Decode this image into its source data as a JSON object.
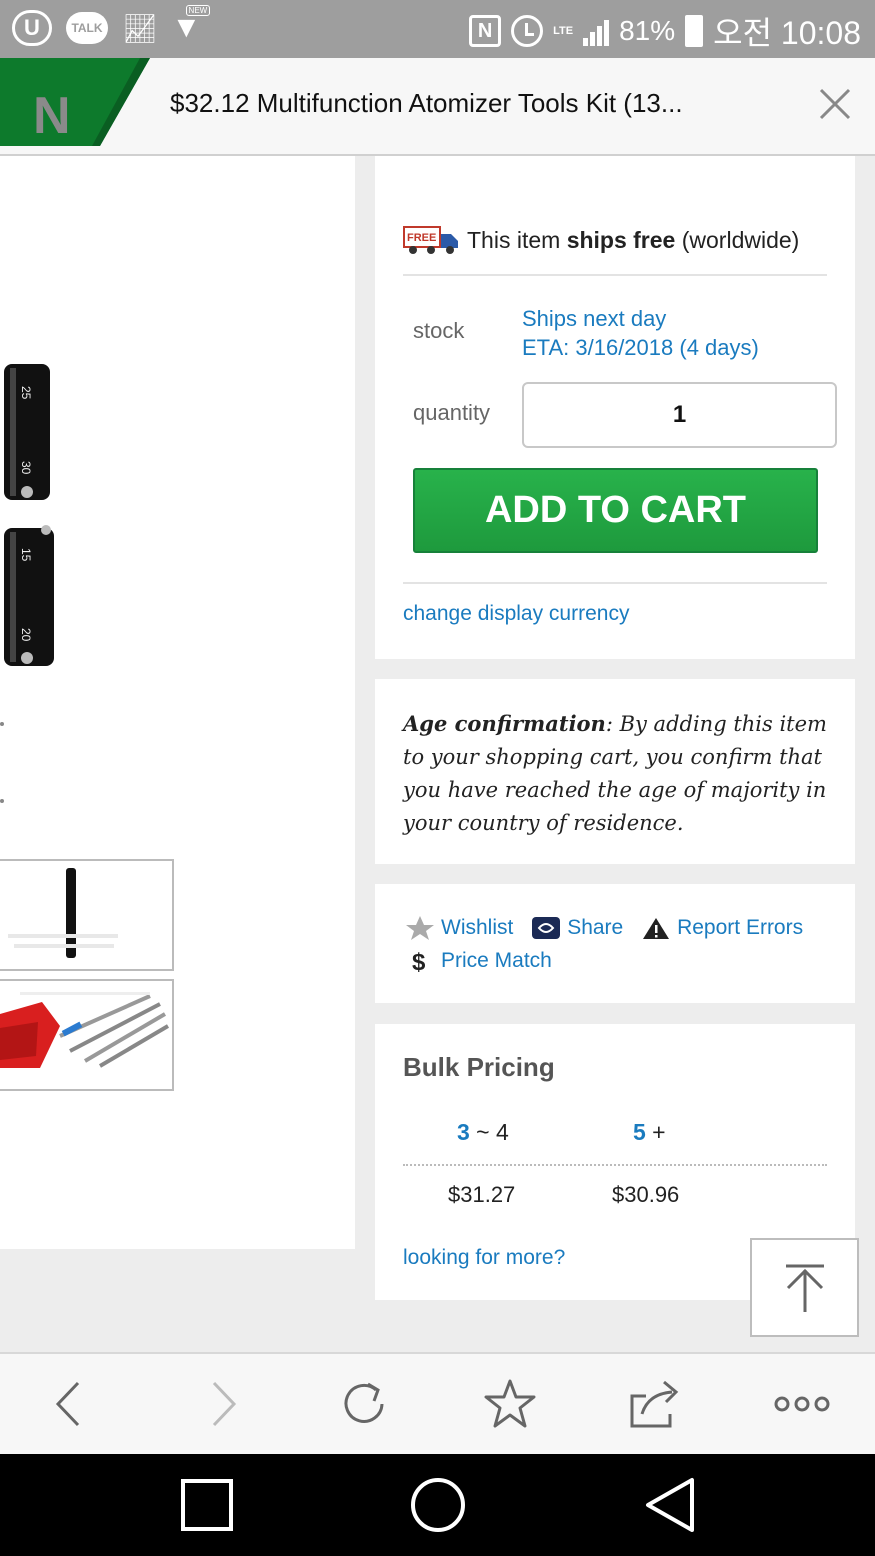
{
  "status_bar": {
    "talk_label": "TALK",
    "new_label": "NEW",
    "lte_label": "LTE",
    "battery": "81%",
    "time": "오전 10:08"
  },
  "browser": {
    "logo": "N",
    "page_title": "$32.12 Multifunction Atomizer Tools Kit (13...",
    "close_icon": "close-icon"
  },
  "shipping": {
    "badge": "FREE",
    "prefix": "This item ",
    "bold": "ships free",
    "suffix": " (worldwide)"
  },
  "stock": {
    "label": "stock",
    "line1": "Ships next day",
    "line2": "ETA: 3/16/2018 (4 days)"
  },
  "quantity": {
    "label": "quantity",
    "value": "1"
  },
  "cart": {
    "button_label": "ADD TO CART",
    "currency_link": "change display currency"
  },
  "age": {
    "title": "Age confirmation",
    "text": ": By adding this item to your shopping cart, you confirm that you have reached the age of majority in your country of residence."
  },
  "actions": {
    "wishlist": "Wishlist",
    "share": "Share",
    "report": "Report Errors",
    "price_match": "Price Match"
  },
  "bulk": {
    "title": "Bulk Pricing",
    "tiers": [
      {
        "min": "3",
        "sep": " ~ ",
        "max": "4",
        "price": "$31.27"
      },
      {
        "min": "5",
        "sep": " +",
        "max": "",
        "price": "$30.96"
      }
    ],
    "more_link": "looking for more?"
  },
  "product_images": {
    "labels": [
      "25",
      "30",
      "15",
      "20"
    ]
  },
  "colors": {
    "brand_green": "#1e9a3d",
    "link_blue": "#1a7bbf",
    "logo_green": "#0d7a2c"
  }
}
